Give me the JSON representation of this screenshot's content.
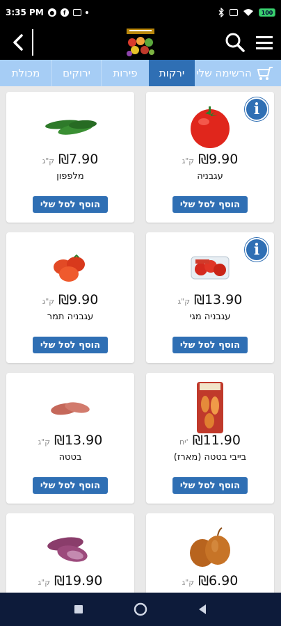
{
  "status_bar": {
    "time": "3:35 PM",
    "battery": "100"
  },
  "header": {
    "back_icon": "chevron-left-icon",
    "search_icon": "search-icon",
    "menu_icon": "hamburger-menu-icon"
  },
  "tabs": {
    "my_list": "הרשימה שלי",
    "items": [
      {
        "label": "ירקות",
        "active": true
      },
      {
        "label": "פירות",
        "active": false
      },
      {
        "label": "ירוקים",
        "active": false
      },
      {
        "label": "מכולת",
        "active": false
      }
    ]
  },
  "products": [
    {
      "name": "עגבניה",
      "price": "9.90",
      "currency": "₪",
      "unit": "ק\"ג",
      "has_info": true,
      "add_label": "הוסף לסל שלי",
      "image": "tomato"
    },
    {
      "name": "מלפפון",
      "price": "7.90",
      "currency": "₪",
      "unit": "ק\"ג",
      "has_info": false,
      "add_label": "הוסף לסל שלי",
      "image": "cucumber"
    },
    {
      "name": "עגבניה מגי",
      "price": "13.90",
      "currency": "₪",
      "unit": "ק\"ג",
      "has_info": true,
      "add_label": "הוסף לסל שלי",
      "image": "tomato-pack"
    },
    {
      "name": "עגבניה תמר",
      "price": "9.90",
      "currency": "₪",
      "unit": "ק\"ג",
      "has_info": false,
      "add_label": "הוסף לסל שלי",
      "image": "plum-tomato"
    },
    {
      "name": "בייבי בטטה (מארז)",
      "price": "11.90",
      "currency": "₪",
      "unit": "יח'",
      "has_info": false,
      "add_label": "הוסף לסל שלי",
      "image": "sweet-potato-bag"
    },
    {
      "name": "בטטה",
      "price": "13.90",
      "currency": "₪",
      "unit": "ק\"ג",
      "has_info": false,
      "add_label": "הוסף לסל שלי",
      "image": "sweet-potato"
    },
    {
      "name": "",
      "price": "6.90",
      "currency": "₪",
      "unit": "ק\"ג",
      "has_info": false,
      "add_label": "",
      "image": "onion"
    },
    {
      "name": "",
      "price": "19.90",
      "currency": "₪",
      "unit": "ק\"ג",
      "has_info": false,
      "add_label": "",
      "image": "purple-sweet-potato"
    }
  ],
  "colors": {
    "accent": "#2f6fb4",
    "tab_bar": "#a6cdf5",
    "header": "#000000",
    "nav": "#0d1b3a"
  }
}
